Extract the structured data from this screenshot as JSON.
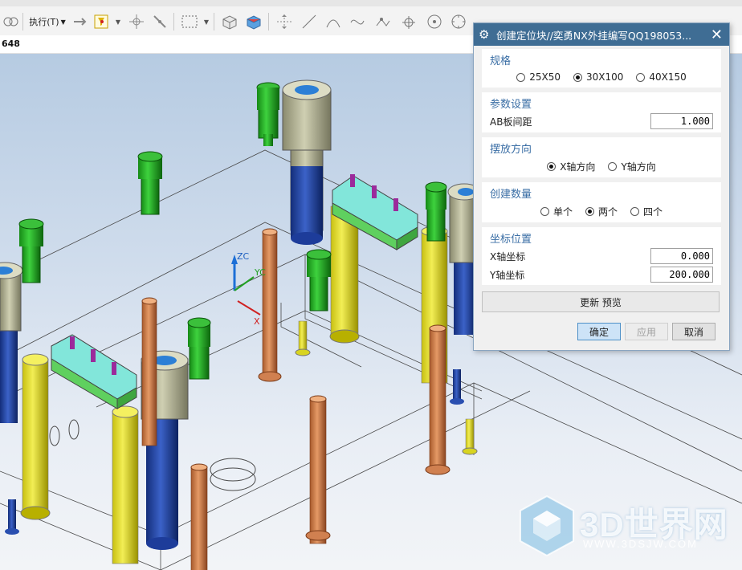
{
  "toolbar": {
    "execute_label": "执行(T)",
    "icons": [
      "tool-icon",
      "execute-icon",
      "arrows-icon",
      "filter-icon",
      "snap-icon",
      "point-icon",
      "select-box-icon",
      "cube-icon",
      "shaded-cube-icon",
      "move-icon",
      "line-icon",
      "arc-icon",
      "spline-icon",
      "perpendicular-icon",
      "circle-icon",
      "tangent-icon"
    ]
  },
  "cmdbar": {
    "text": "648"
  },
  "dialog": {
    "title": "创建定位块//奕勇NX外挂编写QQ198053...",
    "close": "✕",
    "gear": "⚙",
    "spec": {
      "title": "规格",
      "options": [
        {
          "label": "25X50",
          "selected": false
        },
        {
          "label": "30X100",
          "selected": true
        },
        {
          "label": "40X150",
          "selected": false
        }
      ]
    },
    "params": {
      "title": "参数设置",
      "ab_label": "AB板间距",
      "ab_value": "1.000"
    },
    "orientation": {
      "title": "摆放方向",
      "options": [
        {
          "label": "X轴方向",
          "selected": true
        },
        {
          "label": "Y轴方向",
          "selected": false
        }
      ]
    },
    "quantity": {
      "title": "创建数量",
      "options": [
        {
          "label": "单个",
          "selected": false
        },
        {
          "label": "两个",
          "selected": true
        },
        {
          "label": "四个",
          "selected": false
        }
      ]
    },
    "coords": {
      "title": "坐标位置",
      "x_label": "X轴坐标",
      "x_value": "0.000",
      "y_label": "Y轴坐标",
      "y_value": "200.000"
    },
    "update_label": "更新  预览",
    "ok_label": "确定",
    "apply_label": "应用",
    "cancel_label": "取消"
  },
  "viewport": {
    "axis_labels": {
      "z": "ZC",
      "y": "YC",
      "x": "X"
    }
  },
  "watermark": {
    "title": "3D世界网",
    "url": "WWW.3DSJW.COM"
  },
  "colors": {
    "accent": "#3f6d94",
    "group_title": "#3a6ea5",
    "bolt": "#1fa11f",
    "pillar": "#d8d420",
    "pin": "#c97a45",
    "block": "#7fe3d8"
  }
}
